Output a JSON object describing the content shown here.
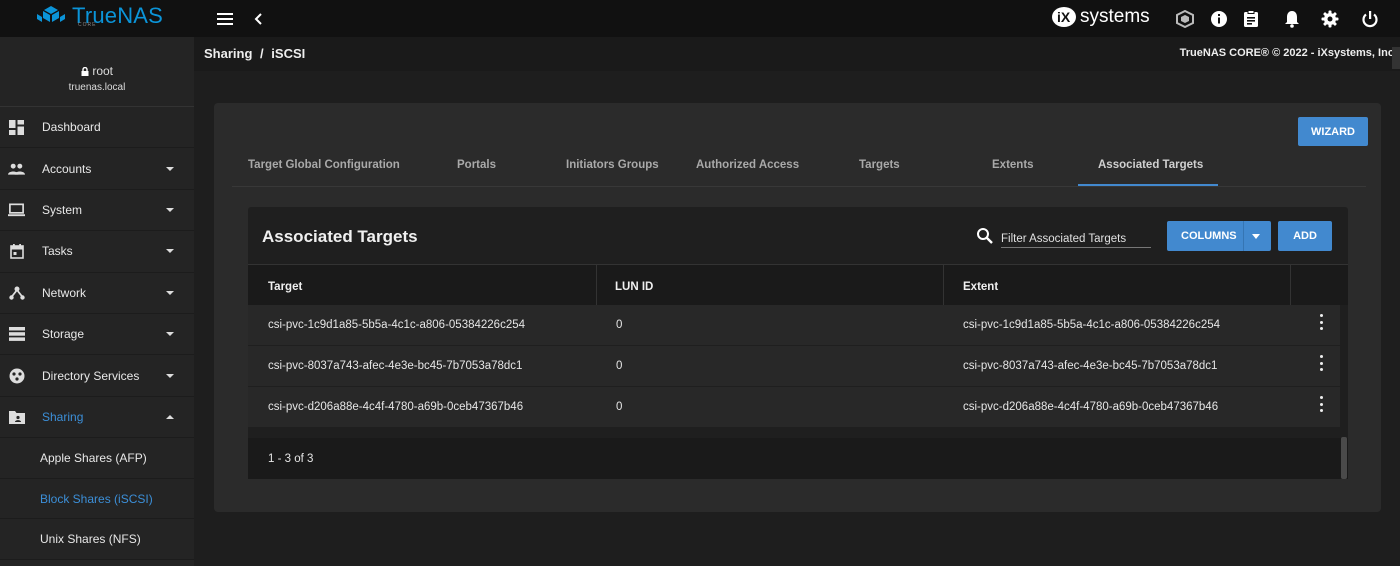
{
  "header": {
    "brand": "TrueNAS",
    "brand_sub": "CORE",
    "vendor": "systems",
    "accent": "#0b94d8"
  },
  "user": {
    "name": "root",
    "host": "truenas.local"
  },
  "sidebar": {
    "items": [
      {
        "label": "Dashboard",
        "icon": "dashboard-icon",
        "caret": false
      },
      {
        "label": "Accounts",
        "icon": "people-icon",
        "caret": true
      },
      {
        "label": "System",
        "icon": "laptop-icon",
        "caret": true
      },
      {
        "label": "Tasks",
        "icon": "calendar-icon",
        "caret": true
      },
      {
        "label": "Network",
        "icon": "network-icon",
        "caret": true
      },
      {
        "label": "Storage",
        "icon": "storage-icon",
        "caret": true
      },
      {
        "label": "Directory Services",
        "icon": "directory-icon",
        "caret": true
      },
      {
        "label": "Sharing",
        "icon": "folder-shared-icon",
        "caret": true,
        "active": true
      }
    ],
    "sub_items": [
      {
        "label": "Apple Shares (AFP)"
      },
      {
        "label": "Block Shares (iSCSI)",
        "active": true
      },
      {
        "label": "Unix Shares (NFS)"
      }
    ]
  },
  "breadcrumb": {
    "parent": "Sharing",
    "sep": "/",
    "current": "iSCSI"
  },
  "copyright": "TrueNAS CORE® © 2022 - iXsystems, Inc.",
  "wizard_label": "WIZARD",
  "tabs": [
    {
      "label": "Target Global Configuration"
    },
    {
      "label": "Portals"
    },
    {
      "label": "Initiators Groups"
    },
    {
      "label": "Authorized Access"
    },
    {
      "label": "Targets"
    },
    {
      "label": "Extents"
    },
    {
      "label": "Associated Targets",
      "active": true
    }
  ],
  "table": {
    "title": "Associated Targets",
    "filter_placeholder": "Filter Associated Targets",
    "columns_label": "COLUMNS",
    "add_label": "ADD",
    "headers": [
      "Target",
      "LUN ID",
      "Extent"
    ],
    "rows": [
      {
        "target": "csi-pvc-1c9d1a85-5b5a-4c1c-a806-05384226c254",
        "lun": "0",
        "extent": "csi-pvc-1c9d1a85-5b5a-4c1c-a806-05384226c254"
      },
      {
        "target": "csi-pvc-8037a743-afec-4e3e-bc45-7b7053a78dc1",
        "lun": "0",
        "extent": "csi-pvc-8037a743-afec-4e3e-bc45-7b7053a78dc1"
      },
      {
        "target": "csi-pvc-d206a88e-4c4f-4780-a69b-0ceb47367b46",
        "lun": "0",
        "extent": "csi-pvc-d206a88e-4c4f-4780-a69b-0ceb47367b46"
      }
    ],
    "paging": "1 - 3 of 3"
  }
}
